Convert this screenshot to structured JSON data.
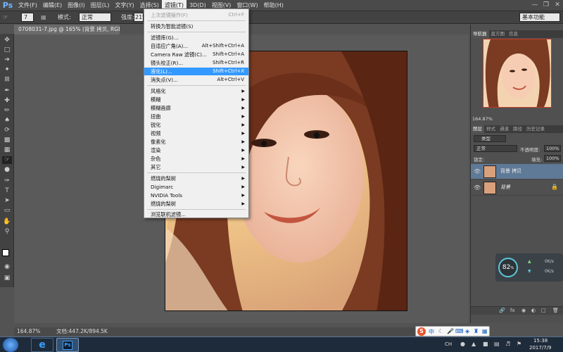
{
  "menubar": {
    "logo": "Ps",
    "items": [
      "文件(F)",
      "编辑(E)",
      "图像(I)",
      "图层(L)",
      "文字(Y)",
      "选择(S)",
      "滤镜(T)",
      "3D(D)",
      "视图(V)",
      "窗口(W)",
      "帮助(H)"
    ],
    "active_index": 6
  },
  "optbar": {
    "mode_label": "模式:",
    "mode_value": "正常",
    "strength_label": "强度:",
    "strength_value": "21%",
    "workspace": "基本功能"
  },
  "doc": {
    "tab_title": "0708031-7.jpg @ 165% (背景 拷贝, RGB/8#) *"
  },
  "filter_menu": {
    "rows": [
      {
        "label": "上次滤镜操作(F)",
        "shortcut": "Ctrl+F",
        "disabled": true
      },
      {
        "label": "转换为智能滤镜(S)"
      },
      {
        "label": "滤镜库(G)..."
      },
      {
        "label": "自适应广角(A)...",
        "shortcut": "Alt+Shift+Ctrl+A"
      },
      {
        "label": "Camera Raw 滤镜(C)...",
        "shortcut": "Shift+Ctrl+A"
      },
      {
        "label": "镜头校正(R)...",
        "shortcut": "Shift+Ctrl+R"
      },
      {
        "label": "液化(L)...",
        "shortcut": "Shift+Ctrl+X",
        "highlighted": true
      },
      {
        "label": "消失点(V)...",
        "shortcut": "Alt+Ctrl+V"
      },
      {
        "label": "风格化"
      },
      {
        "label": "模糊"
      },
      {
        "label": "模糊画廊"
      },
      {
        "label": "扭曲"
      },
      {
        "label": "锐化"
      },
      {
        "label": "视频"
      },
      {
        "label": "像素化"
      },
      {
        "label": "渲染"
      },
      {
        "label": "杂色"
      },
      {
        "label": "其它"
      },
      {
        "label": "燃烧的梨树"
      },
      {
        "label": "Digimarc"
      },
      {
        "label": "NVIDIA Tools"
      },
      {
        "label": "燃烧的梨树"
      },
      {
        "label": "浏览联机滤镜..."
      }
    ]
  },
  "navigator": {
    "tabs": [
      "导航器",
      "直方图",
      "信息"
    ],
    "zoom": "164.87%"
  },
  "layers_panel": {
    "tabs": [
      "图层",
      "样式",
      "通道",
      "路径",
      "历史记录"
    ],
    "filter_label": "类型",
    "blend_mode": "正常",
    "opacity_label": "不透明度:",
    "opacity_value": "100%",
    "lock_label": "锁定:",
    "fill_label": "填充:",
    "fill_value": "100%",
    "layers": [
      {
        "name": "背景 拷贝",
        "selected": true
      },
      {
        "name": "背景",
        "selected": false
      }
    ]
  },
  "status": {
    "zoom": "164.87%",
    "doc_info": "文档:447.2K/894.5K"
  },
  "speed_widget": {
    "percent": "82",
    "percent_unit": "%",
    "up": "0K/s",
    "down": "0K/s"
  },
  "ime": {
    "label": "中"
  },
  "taskbar": {
    "time": "15:38",
    "date": "2017/7/9",
    "lang": "CH"
  },
  "colors": {
    "menu_highlight": "#3399ff",
    "ps_blue": "#74b7ff"
  }
}
